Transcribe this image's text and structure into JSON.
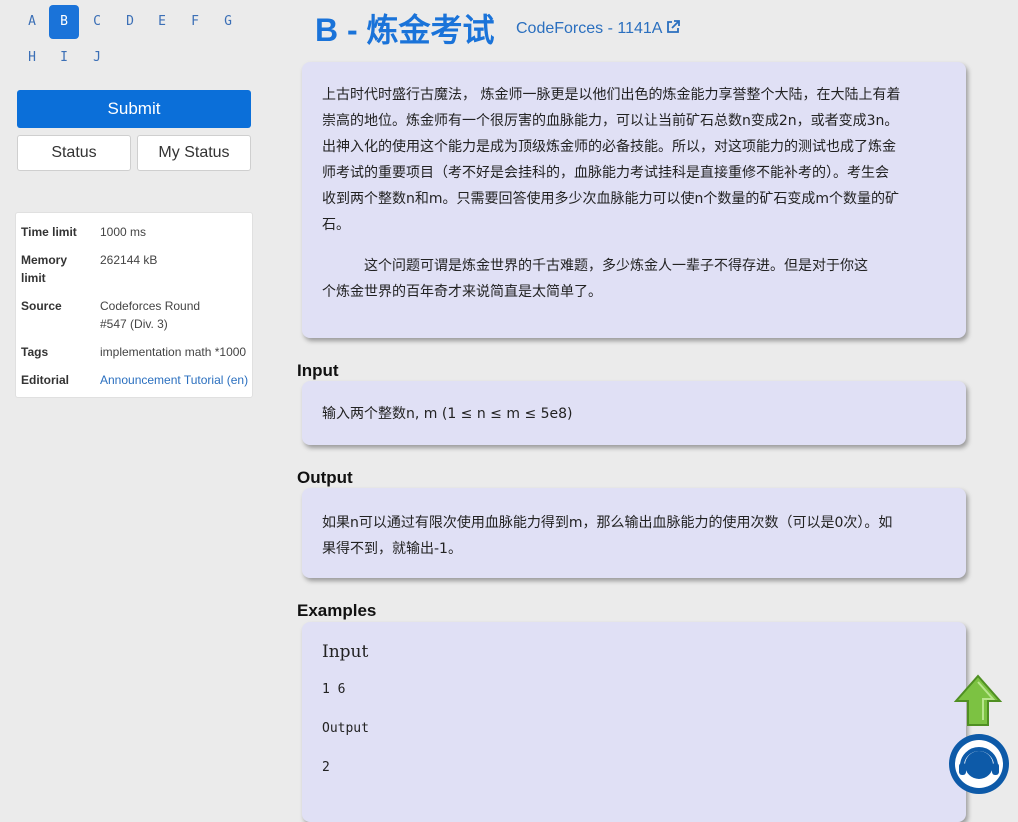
{
  "problem_nav": {
    "letters": [
      "A",
      "B",
      "C",
      "D",
      "E",
      "F",
      "G",
      "H",
      "I",
      "J"
    ],
    "active": "B"
  },
  "actions": {
    "submit": "Submit",
    "status": "Status",
    "my_status": "My Status"
  },
  "info": {
    "time_limit_label": "Time limit",
    "time_limit": "1000 ms",
    "memory_limit_label": "Memory limit",
    "memory_limit": "262144 kB",
    "source_label": "Source",
    "source": "Codeforces Round #547 (Div. 3)",
    "tags_label": "Tags",
    "tags": "implementation math *1000",
    "editorial_label": "Editorial",
    "editorial_links": [
      "Announcement",
      "Tutorial (en)"
    ]
  },
  "problem": {
    "title": "B - 炼金考试",
    "origin": "CodeForces - 1141A",
    "description_p1_lines": [
      "上古时代时盛行古魔法，  炼金师一脉更是以他们出色的炼金能力享誉整个大陆，在大陆上有着",
      "崇高的地位。炼金师有一个很厉害的血脉能力，可以让当前矿石总数n变成2n，或者变成3n。",
      "出神入化的使用这个能力是成为顶级炼金师的必备技能。所以，对这项能力的测试也成了炼金",
      "师考试的重要项目（考不好是会挂科的，血脉能力考试挂科是直接重修不能补考的）。考生会",
      "收到两个整数n和m。只需要回答使用多少次血脉能力可以使n个数量的矿石变成m个数量的矿",
      "石。"
    ],
    "description_p2_lines": [
      "　　　这个问题可谓是炼金世界的千古难题，多少炼金人一辈子不得存进。但是对于你这",
      "个炼金世界的百年奇才来说简直是太简单了。"
    ],
    "input_heading": "Input",
    "input_text": "输入两个整数n, m (1 ≤ n ≤ m ≤ 5e8)",
    "output_heading": "Output",
    "output_lines": [
      "如果n可以通过有限次使用血脉能力得到m，那么输出血脉能力的使用次数（可以是0次）。如",
      "果得不到，就输出-1。"
    ],
    "examples_heading": "Examples",
    "example_input_label": "Input",
    "example_input": "1 6",
    "example_output_label": "Output",
    "example_output": "2"
  },
  "icons": {
    "to_top": "arrow-up-icon",
    "help": "headset-icon"
  },
  "colors": {
    "accent": "#1a73d9",
    "card_bg": "#e0e0f5",
    "to_top": "#7cc242",
    "help": "#0d5aa8"
  }
}
